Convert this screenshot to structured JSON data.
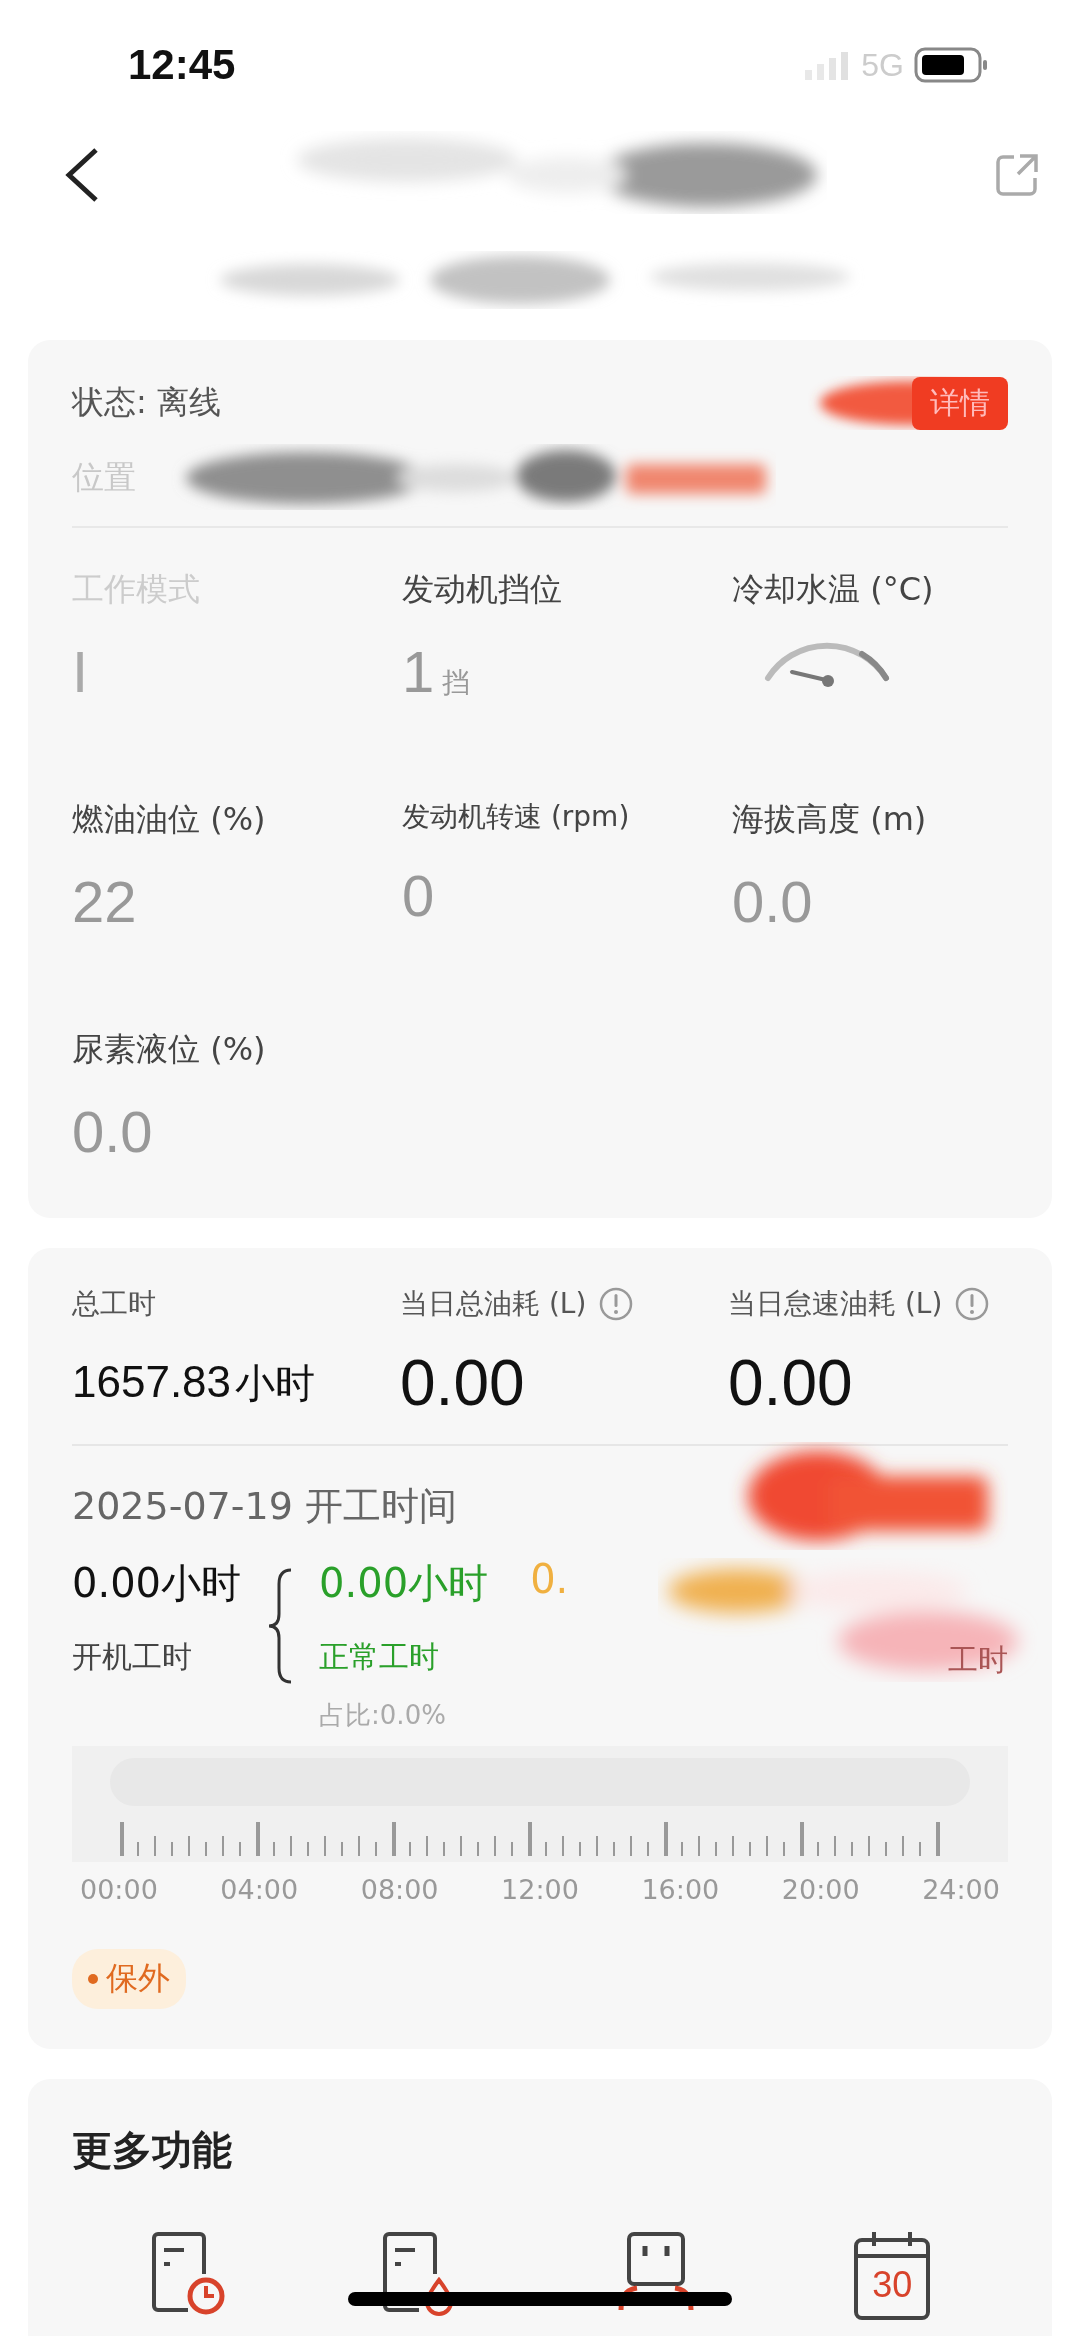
{
  "status_bar": {
    "time": "12:45",
    "network": "5G"
  },
  "status_card": {
    "status": "状态: 离线",
    "detail_button": "详情",
    "location_label": "位置",
    "metrics": [
      {
        "label": "工作模式",
        "value": "I",
        "kind": "text",
        "faded": true
      },
      {
        "label": "发动机挡位",
        "value": "1",
        "unit": "挡",
        "kind": "text",
        "faded": false
      },
      {
        "label": "冷却水温 (°C)",
        "kind": "gauge",
        "faded": false
      },
      {
        "label": "燃油油位 (%)",
        "value": "22",
        "kind": "text",
        "faded": false
      },
      {
        "label": "发动机转速 (rpm)",
        "value": "0",
        "kind": "text",
        "faded": false
      },
      {
        "label": "海拔高度 (m)",
        "value": "0.0",
        "kind": "text",
        "faded": false
      },
      {
        "label": "尿素液位 (%)",
        "value": "0.0",
        "kind": "text",
        "faded": false
      }
    ]
  },
  "stats": [
    {
      "label": "总工时",
      "value": "1657.83",
      "unit": "小时",
      "kind": "hours"
    },
    {
      "label": "当日总油耗 (L)",
      "value": "0.00",
      "kind": "fuel"
    },
    {
      "label": "当日怠速油耗 (L)",
      "value": "0.00",
      "kind": "fuel"
    }
  ],
  "work_time": {
    "title": "2025-07-19 开工时间",
    "total_value": "0.00小时",
    "total_label": "开机工时",
    "normal_value": "0.00小时",
    "normal_label": "正常工时",
    "ratio": "占比:0.0%",
    "idle_value": "0.",
    "idle_label": "工时"
  },
  "timeline": {
    "ticks": [
      "00:00",
      "04:00",
      "08:00",
      "12:00",
      "16:00",
      "20:00",
      "24:00"
    ]
  },
  "badge": "保外",
  "more": {
    "title": "更多功能",
    "calendar_day": "30"
  }
}
